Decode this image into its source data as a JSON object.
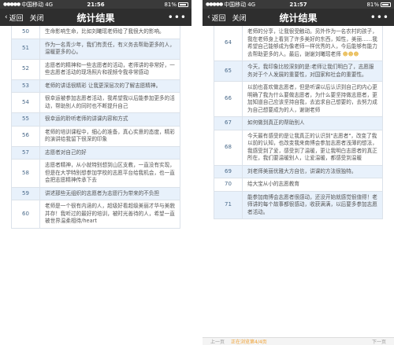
{
  "left": {
    "status": {
      "carrier": "中国移动",
      "network": "4G",
      "time": "21:56",
      "battery": "81%"
    },
    "nav": {
      "back": "返回",
      "close": "关闭",
      "title": "统计结果",
      "more": "•••"
    },
    "rows": [
      {
        "n": "50",
        "t": "生命影响生命，比如刘曦瑶老师给了我很大的影响。"
      },
      {
        "n": "51",
        "t": "作为一名青少年，我们有责任，有义务去帮助更多的人，温暖更多的心。"
      },
      {
        "n": "52",
        "t": "志愿者的精神和一些志愿者的活动，老师讲的非常好，一些志愿者活动的现场照片和视频令我非常感动"
      },
      {
        "n": "53",
        "t": "老师的讲话很精彩 让我更深层次的了解志愿精神。"
      },
      {
        "n": "54",
        "t": "很幸运被参加志愿者活动，我希望我以后能参加更多的活动，帮助别人的同时也不断提升自己"
      },
      {
        "n": "55",
        "t": "很幸运的聆听老师的讲课内容和方式"
      },
      {
        "n": "56",
        "t": "老师的培训课程中，细心的准备，真心实意的态度，精彩的演讲给我留下很深的印象"
      },
      {
        "n": "57",
        "t": "志愿者对自己的好"
      },
      {
        "n": "58",
        "t": "志愿者精神，从小就特别想到山区支教，一直没有实现，但是在大学特别想参加学校的志愿平台给我机会，也一直会把志愿精神传承下去"
      },
      {
        "n": "59",
        "t": "讲述那些无组织的志愿者为志愿行为带来的不负担"
      },
      {
        "n": "60",
        "t": "老师是一个很有内涵的人，超级好看超级美丽才华与美貌并存！我听过的最好的培训，被时光善待的人，希望一直被世界温柔相待/heart"
      }
    ]
  },
  "right": {
    "status": {
      "carrier": "中国移动",
      "network": "4G",
      "time": "21:57",
      "battery": "81%"
    },
    "nav": {
      "back": "返回",
      "close": "关闭",
      "title": "统计结果",
      "more": "•••"
    },
    "rows": [
      {
        "n": "",
        "t": "老师的分享，让我很受触动。另外作为一名农村的孩子，我在老师身上看到了许多美好的东西，知性，美丽……我希望自己能够成为像老师一样优秀的人，今后能够有能力去帮助更多的人。最后，谢谢刘曦瑶老师"
      },
      {
        "n": "64",
        "t": ""
      },
      {
        "n": "65",
        "t": "今天，我印象比较深刻的是:老师让我们明白了，志愿服务对于个人发展的重要性，对国家和社会的重要性。"
      },
      {
        "n": "66",
        "t": "以前也喜欢做志愿者，但是听课以后认识到自己的内心更明确了我为什么要做志愿者，为什么要坚持做志愿者，更加知道自己应该坚持自我，去追求自己想要的，去努力成为自己想要成为的人，谢谢老师"
      },
      {
        "n": "67",
        "t": "如何做到真正的帮助别人"
      },
      {
        "n": "68",
        "t": "今天最有感受的是让我真正的认识到\"志愿者\"，改变了我以前的认知，也改变我来南博会参加志愿者浅薄的想法，我感受到了爱，感受到了温暖，更让我明白志愿者的真正所在，我们要温暖别人，让爱温暖，都感受到温暖"
      },
      {
        "n": "69",
        "t": "刘老师美丽优雅大方自信，讲课的方法很独特。"
      },
      {
        "n": "70",
        "t": "给大宝从小的志愿教育"
      },
      {
        "n": "71",
        "t": "能参加南博会志愿者很感动，还没开始就感觉很值得！老师讲的每个故事都很感动，收获满满，以后要多参加志愿者活动。"
      }
    ],
    "bottom": {
      "prev": "上一页",
      "page_info": "正在浏览第4/4页",
      "next": "下一页"
    }
  }
}
